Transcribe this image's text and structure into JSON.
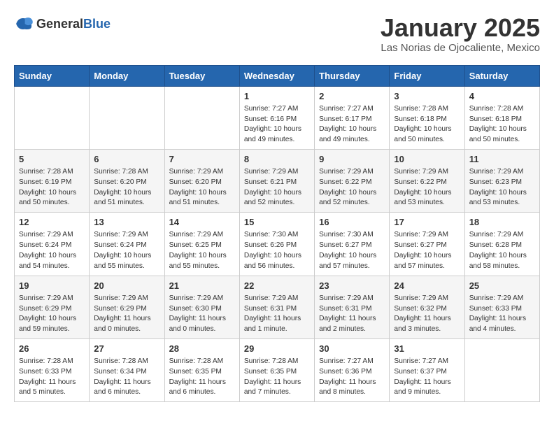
{
  "logo": {
    "general": "General",
    "blue": "Blue"
  },
  "title": "January 2025",
  "subtitle": "Las Norias de Ojocaliente, Mexico",
  "days_of_week": [
    "Sunday",
    "Monday",
    "Tuesday",
    "Wednesday",
    "Thursday",
    "Friday",
    "Saturday"
  ],
  "weeks": [
    [
      {
        "day": "",
        "info": ""
      },
      {
        "day": "",
        "info": ""
      },
      {
        "day": "",
        "info": ""
      },
      {
        "day": "1",
        "info": "Sunrise: 7:27 AM\nSunset: 6:16 PM\nDaylight: 10 hours and 49 minutes."
      },
      {
        "day": "2",
        "info": "Sunrise: 7:27 AM\nSunset: 6:17 PM\nDaylight: 10 hours and 49 minutes."
      },
      {
        "day": "3",
        "info": "Sunrise: 7:28 AM\nSunset: 6:18 PM\nDaylight: 10 hours and 50 minutes."
      },
      {
        "day": "4",
        "info": "Sunrise: 7:28 AM\nSunset: 6:18 PM\nDaylight: 10 hours and 50 minutes."
      }
    ],
    [
      {
        "day": "5",
        "info": "Sunrise: 7:28 AM\nSunset: 6:19 PM\nDaylight: 10 hours and 50 minutes."
      },
      {
        "day": "6",
        "info": "Sunrise: 7:28 AM\nSunset: 6:20 PM\nDaylight: 10 hours and 51 minutes."
      },
      {
        "day": "7",
        "info": "Sunrise: 7:29 AM\nSunset: 6:20 PM\nDaylight: 10 hours and 51 minutes."
      },
      {
        "day": "8",
        "info": "Sunrise: 7:29 AM\nSunset: 6:21 PM\nDaylight: 10 hours and 52 minutes."
      },
      {
        "day": "9",
        "info": "Sunrise: 7:29 AM\nSunset: 6:22 PM\nDaylight: 10 hours and 52 minutes."
      },
      {
        "day": "10",
        "info": "Sunrise: 7:29 AM\nSunset: 6:22 PM\nDaylight: 10 hours and 53 minutes."
      },
      {
        "day": "11",
        "info": "Sunrise: 7:29 AM\nSunset: 6:23 PM\nDaylight: 10 hours and 53 minutes."
      }
    ],
    [
      {
        "day": "12",
        "info": "Sunrise: 7:29 AM\nSunset: 6:24 PM\nDaylight: 10 hours and 54 minutes."
      },
      {
        "day": "13",
        "info": "Sunrise: 7:29 AM\nSunset: 6:24 PM\nDaylight: 10 hours and 55 minutes."
      },
      {
        "day": "14",
        "info": "Sunrise: 7:29 AM\nSunset: 6:25 PM\nDaylight: 10 hours and 55 minutes."
      },
      {
        "day": "15",
        "info": "Sunrise: 7:30 AM\nSunset: 6:26 PM\nDaylight: 10 hours and 56 minutes."
      },
      {
        "day": "16",
        "info": "Sunrise: 7:30 AM\nSunset: 6:27 PM\nDaylight: 10 hours and 57 minutes."
      },
      {
        "day": "17",
        "info": "Sunrise: 7:29 AM\nSunset: 6:27 PM\nDaylight: 10 hours and 57 minutes."
      },
      {
        "day": "18",
        "info": "Sunrise: 7:29 AM\nSunset: 6:28 PM\nDaylight: 10 hours and 58 minutes."
      }
    ],
    [
      {
        "day": "19",
        "info": "Sunrise: 7:29 AM\nSunset: 6:29 PM\nDaylight: 10 hours and 59 minutes."
      },
      {
        "day": "20",
        "info": "Sunrise: 7:29 AM\nSunset: 6:29 PM\nDaylight: 11 hours and 0 minutes."
      },
      {
        "day": "21",
        "info": "Sunrise: 7:29 AM\nSunset: 6:30 PM\nDaylight: 11 hours and 0 minutes."
      },
      {
        "day": "22",
        "info": "Sunrise: 7:29 AM\nSunset: 6:31 PM\nDaylight: 11 hours and 1 minute."
      },
      {
        "day": "23",
        "info": "Sunrise: 7:29 AM\nSunset: 6:31 PM\nDaylight: 11 hours and 2 minutes."
      },
      {
        "day": "24",
        "info": "Sunrise: 7:29 AM\nSunset: 6:32 PM\nDaylight: 11 hours and 3 minutes."
      },
      {
        "day": "25",
        "info": "Sunrise: 7:29 AM\nSunset: 6:33 PM\nDaylight: 11 hours and 4 minutes."
      }
    ],
    [
      {
        "day": "26",
        "info": "Sunrise: 7:28 AM\nSunset: 6:33 PM\nDaylight: 11 hours and 5 minutes."
      },
      {
        "day": "27",
        "info": "Sunrise: 7:28 AM\nSunset: 6:34 PM\nDaylight: 11 hours and 6 minutes."
      },
      {
        "day": "28",
        "info": "Sunrise: 7:28 AM\nSunset: 6:35 PM\nDaylight: 11 hours and 6 minutes."
      },
      {
        "day": "29",
        "info": "Sunrise: 7:28 AM\nSunset: 6:35 PM\nDaylight: 11 hours and 7 minutes."
      },
      {
        "day": "30",
        "info": "Sunrise: 7:27 AM\nSunset: 6:36 PM\nDaylight: 11 hours and 8 minutes."
      },
      {
        "day": "31",
        "info": "Sunrise: 7:27 AM\nSunset: 6:37 PM\nDaylight: 11 hours and 9 minutes."
      },
      {
        "day": "",
        "info": ""
      }
    ]
  ]
}
